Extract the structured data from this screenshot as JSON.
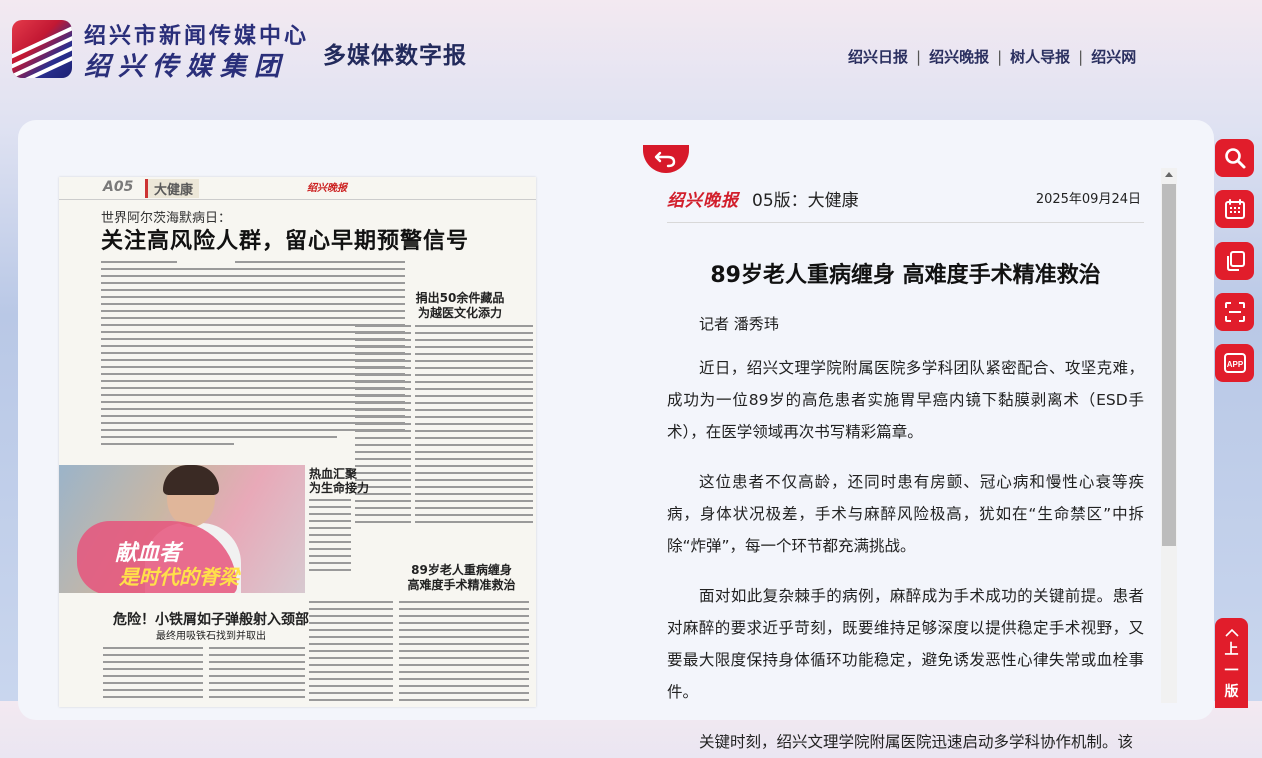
{
  "header": {
    "org_name": "绍兴市新闻传媒中心",
    "group_name": "绍兴传媒集团",
    "site_title": "多媒体数字报",
    "nav": [
      "绍兴日报",
      "绍兴晚报",
      "树人导报",
      "绍兴网"
    ],
    "nav_separator": "|"
  },
  "page_preview": {
    "section_code": "A05",
    "category": "大健康",
    "brand": "绍兴晚报",
    "kicker": "世界阿尔茨海默病日：",
    "headline": "关注高风险人群，留心早期预警信号",
    "side_headline": "捐出50余件藏品\n为越医文化添力",
    "photo_headline": "热血汇聚\n为生命接力",
    "photo_slogan_1": "献血者",
    "photo_slogan_2": "是时代的脊梁",
    "story2_headline": "89岁老人重病缠身\n高难度手术精准救治",
    "story3_headline": "危险！小铁屑如子弹般射入颈部",
    "story3_subhead": "最终用吸铁石找到并取出"
  },
  "article": {
    "paper_logo": "绍兴晚报",
    "edition": "05版：大健康",
    "date": "2025年09月24日",
    "title": "89岁老人重病缠身 高难度手术精准救治",
    "byline": "记者 潘秀玮",
    "paragraphs": [
      "近日，绍兴文理学院附属医院多学科团队紧密配合、攻坚克难，成功为一位89岁的高危患者实施胃早癌内镜下黏膜剥离术（ESD手术），在医学领域再次书写精彩篇章。",
      "这位患者不仅高龄，还同时患有房颤、冠心病和慢性心衰等疾病，身体状况极差，手术与麻醉风险极高，犹如在“生命禁区”中拆除“炸弹”，每一个环节都充满挑战。",
      "面对如此复杂棘手的病例，麻醉成为手术成功的关键前提。患者对麻醉的要求近乎苛刻，既要维持足够深度以提供稳定手术视野，又要最大限度保持身体循环功能稳定，避免诱发恶性心律失常或血栓事件。",
      "关键时刻，绍兴文理学院附属医院迅速启动多学科协作机制。该"
    ]
  },
  "tools": {
    "search": "search-icon",
    "calendar": "calendar-icon",
    "copy": "copy-icon",
    "scan": "scan-icon",
    "app": "APP",
    "prev_page": "上一版"
  },
  "colors": {
    "accent": "#e11d2b",
    "brand_blue": "#2a2f7a"
  }
}
